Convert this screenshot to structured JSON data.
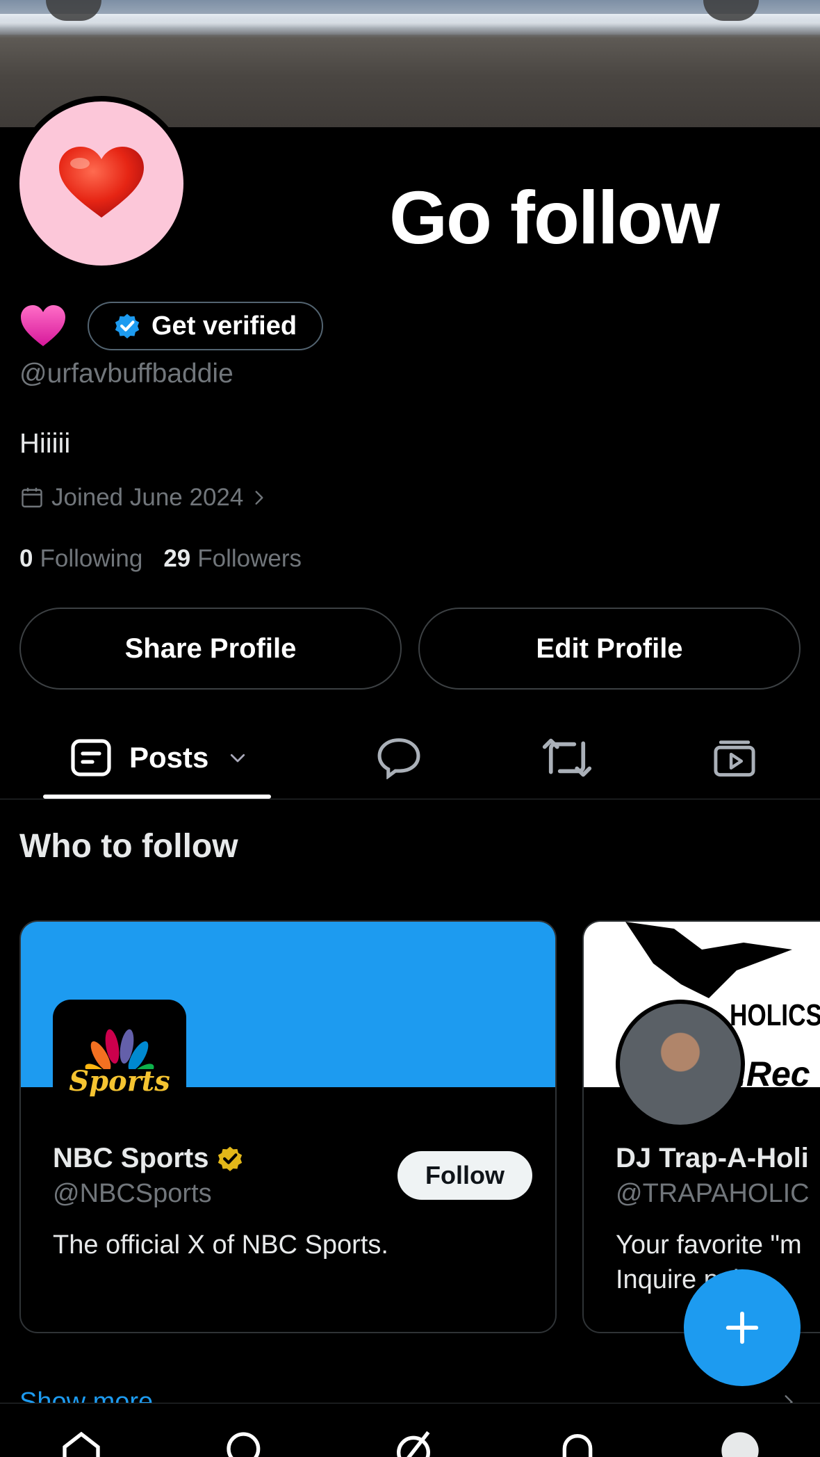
{
  "profile": {
    "banner_text": "Go follow",
    "display_name_emoji": "💗",
    "avatar_emoji": "❤️",
    "get_verified_label": "Get verified",
    "handle": "@urfavbuffbaddie",
    "bio": "Hiiiii",
    "joined": "Joined June 2024",
    "following_count": "0",
    "following_label": "Following",
    "followers_count": "29",
    "followers_label": "Followers",
    "share_profile_label": "Share Profile",
    "edit_profile_label": "Edit Profile"
  },
  "tabs": {
    "posts_label": "Posts",
    "items": [
      "posts-icon",
      "replies-icon",
      "reposts-icon",
      "media-icon"
    ]
  },
  "who_to_follow": {
    "title": "Who to follow",
    "cards": [
      {
        "name": "NBC Sports",
        "handle": "@NBCSports",
        "description": "The official X of NBC Sports.",
        "follow_label": "Follow",
        "logo_text": "Sports",
        "verified_color": "#e2b719"
      },
      {
        "name": "DJ Trap-A-Holi",
        "handle": "@TRAPAHOLIC",
        "description_line1": "Your favorite \"m",
        "description_line2": "Inquire   pah",
        "banner_text": "HOLICS",
        "banner_text2": ".Rec"
      }
    ],
    "show_more": "Show more"
  },
  "colors": {
    "accent": "#1d9bf0",
    "background": "#000000",
    "muted": "#71767b",
    "text": "#e7e9ea"
  }
}
